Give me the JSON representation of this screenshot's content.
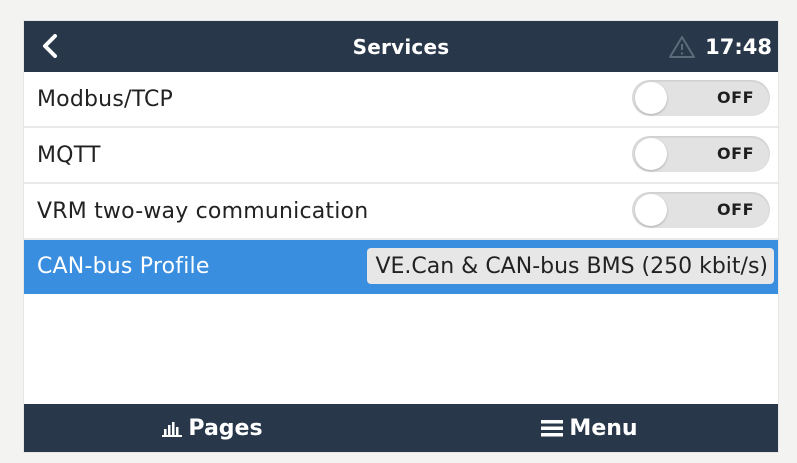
{
  "header": {
    "title": "Services",
    "time": "17:48",
    "back_icon": "chevron-left-icon",
    "warning_icon": "warning-icon"
  },
  "rows": [
    {
      "label": "Modbus/TCP",
      "state": "OFF"
    },
    {
      "label": "MQTT",
      "state": "OFF"
    },
    {
      "label": "VRM two-way communication",
      "state": "OFF"
    }
  ],
  "canbus": {
    "label": "CAN-bus Profile",
    "value": "VE.Can & CAN-bus BMS (250 kbit/s)"
  },
  "footer": {
    "pages_label": "Pages",
    "pages_icon": "bar-chart-icon",
    "menu_label": "Menu",
    "menu_icon": "hamburger-menu-icon"
  },
  "colors": {
    "header_bg": "#28384a",
    "selected_bg": "#3a8ee0",
    "toggle_bg": "#e2e2e2"
  }
}
